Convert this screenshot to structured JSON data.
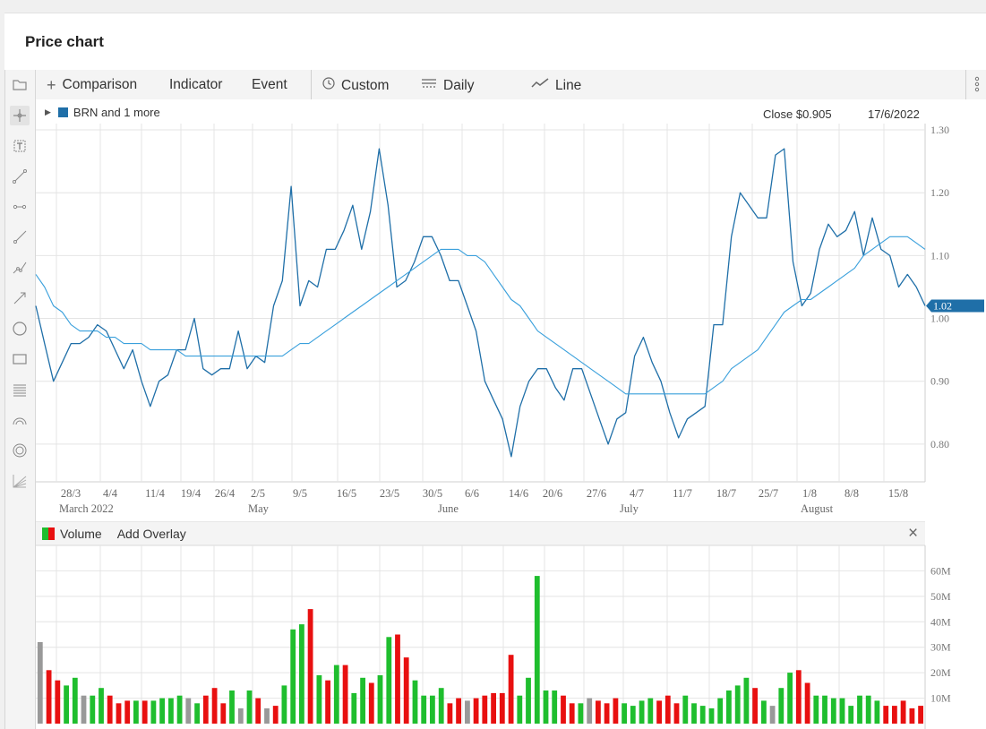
{
  "page": {
    "title": "Price chart"
  },
  "toolbar": {
    "comparison_label": "Comparison",
    "indicator_label": "Indicator",
    "event_label": "Event",
    "custom_label": "Custom",
    "daily_label": "Daily",
    "line_label": "Line"
  },
  "left_tools": [
    "folder-icon",
    "crosshair-icon",
    "text-box-icon",
    "trend-line-icon",
    "horizontal-segment-icon",
    "ray-line-icon",
    "polyline-icon",
    "arrow-line-icon",
    "circle-icon",
    "rectangle-icon",
    "fibonacci-lines-icon",
    "arcs-icon",
    "concentric-circles-icon",
    "fan-lines-icon"
  ],
  "legend": {
    "series_label": "BRN and 1 more",
    "close_text": "Close $0.905",
    "date_text": "17/6/2022",
    "last_value_tag": "1.02",
    "series_color": "#1f6fa8"
  },
  "volume_panel": {
    "title": "Volume",
    "add_overlay_label": "Add Overlay",
    "close_symbol": "×"
  },
  "colors": {
    "up": "#1fbe2e",
    "down": "#e81010",
    "neutral": "#999999",
    "price": "#1f6fa8",
    "ma": "#3aa0dc"
  },
  "chart_data": [
    {
      "type": "line",
      "y_ticks": [
        "1.30",
        "1.20",
        "1.10",
        "1.00",
        "0.90",
        "0.80"
      ],
      "x_ticks": [
        "28/3",
        "4/4",
        "11/4",
        "19/4",
        "26/4",
        "2/5",
        "9/5",
        "16/5",
        "23/5",
        "30/5",
        "6/6",
        "14/6",
        "20/6",
        "27/6",
        "4/7",
        "11/7",
        "18/7",
        "25/7",
        "1/8",
        "8/8",
        "15/8"
      ],
      "month_labels": [
        "March 2022",
        "May",
        "June",
        "July",
        "August"
      ],
      "ylim": [
        0.74,
        1.31
      ],
      "grid": true,
      "series": [
        {
          "values": [
            1.02,
            0.96,
            0.9,
            0.93,
            0.96,
            0.96,
            0.97,
            0.99,
            0.98,
            0.95,
            0.92,
            0.95,
            0.9,
            0.86,
            0.9,
            0.91,
            0.95,
            0.95,
            1.0,
            0.92,
            0.91,
            0.92,
            0.92,
            0.98,
            0.92,
            0.94,
            0.93,
            1.02,
            1.06,
            1.21,
            1.02,
            1.06,
            1.05,
            1.11,
            1.11,
            1.14,
            1.18,
            1.11,
            1.17,
            1.27,
            1.18,
            1.05,
            1.06,
            1.09,
            1.13,
            1.13,
            1.1,
            1.06,
            1.06,
            1.02,
            0.98,
            0.9,
            0.87,
            0.84,
            0.78,
            0.86,
            0.9,
            0.92,
            0.92,
            0.89,
            0.87,
            0.92,
            0.92,
            0.88,
            0.84,
            0.8,
            0.84,
            0.85,
            0.94,
            0.97,
            0.93,
            0.9,
            0.85,
            0.81,
            0.84,
            0.85,
            0.86,
            0.99,
            0.99,
            1.13,
            1.2,
            1.18,
            1.16,
            1.16,
            1.26,
            1.27,
            1.09,
            1.02,
            1.04,
            1.11,
            1.15,
            1.13,
            1.14,
            1.17,
            1.1,
            1.16,
            1.11,
            1.1,
            1.05,
            1.07,
            1.05,
            1.02
          ]
        },
        {
          "values": [
            1.07,
            1.05,
            1.02,
            1.01,
            0.99,
            0.98,
            0.98,
            0.98,
            0.97,
            0.97,
            0.96,
            0.96,
            0.96,
            0.95,
            0.95,
            0.95,
            0.95,
            0.94,
            0.94,
            0.94,
            0.94,
            0.94,
            0.94,
            0.94,
            0.94,
            0.94,
            0.94,
            0.94,
            0.94,
            0.95,
            0.96,
            0.96,
            0.97,
            0.98,
            0.99,
            1.0,
            1.01,
            1.02,
            1.03,
            1.04,
            1.05,
            1.06,
            1.07,
            1.08,
            1.09,
            1.1,
            1.11,
            1.11,
            1.11,
            1.1,
            1.1,
            1.09,
            1.07,
            1.05,
            1.03,
            1.02,
            1.0,
            0.98,
            0.97,
            0.96,
            0.95,
            0.94,
            0.93,
            0.92,
            0.91,
            0.9,
            0.89,
            0.88,
            0.88,
            0.88,
            0.88,
            0.88,
            0.88,
            0.88,
            0.88,
            0.88,
            0.88,
            0.89,
            0.9,
            0.92,
            0.93,
            0.94,
            0.95,
            0.97,
            0.99,
            1.01,
            1.02,
            1.03,
            1.03,
            1.04,
            1.05,
            1.06,
            1.07,
            1.08,
            1.1,
            1.11,
            1.12,
            1.13,
            1.13,
            1.13,
            1.12,
            1.11
          ]
        }
      ]
    },
    {
      "type": "bar",
      "y_ticks": [
        "60M",
        "50M",
        "40M",
        "30M",
        "20M",
        "10M"
      ],
      "ylim": [
        0,
        70
      ],
      "grid": true,
      "values": [
        32,
        21,
        17,
        15,
        18,
        11,
        11,
        14,
        11,
        8,
        9,
        9,
        9,
        9,
        10,
        10,
        11,
        10,
        8,
        11,
        14,
        8,
        13,
        6,
        13,
        10,
        6,
        7,
        15,
        37,
        39,
        45,
        19,
        17,
        23,
        23,
        12,
        18,
        16,
        19,
        34,
        35,
        26,
        17,
        11,
        11,
        14,
        8,
        10,
        9,
        10,
        11,
        12,
        12,
        27,
        11,
        18,
        58,
        13,
        13,
        11,
        8,
        8,
        10,
        9,
        8,
        10,
        8,
        7,
        9,
        10,
        9,
        11,
        8,
        11,
        8,
        7,
        6,
        10,
        13,
        15,
        18,
        14,
        9,
        7,
        14,
        20,
        21,
        16,
        11,
        11,
        10,
        10,
        7,
        11,
        11,
        9,
        7,
        7,
        9,
        6,
        7
      ],
      "colors": [
        "n",
        "d",
        "d",
        "u",
        "u",
        "n",
        "u",
        "u",
        "d",
        "d",
        "d",
        "u",
        "d",
        "u",
        "u",
        "u",
        "u",
        "n",
        "u",
        "d",
        "d",
        "d",
        "u",
        "n",
        "u",
        "d",
        "n",
        "d",
        "u",
        "u",
        "u",
        "d",
        "u",
        "d",
        "u",
        "d",
        "u",
        "u",
        "d",
        "u",
        "u",
        "d",
        "d",
        "u",
        "u",
        "u",
        "u",
        "d",
        "d",
        "n",
        "d",
        "d",
        "d",
        "d",
        "d",
        "u",
        "u",
        "u",
        "u",
        "u",
        "d",
        "d",
        "u",
        "n",
        "d",
        "d",
        "d",
        "u",
        "u",
        "u",
        "u",
        "d",
        "d",
        "d",
        "u",
        "u",
        "u",
        "u",
        "u",
        "u",
        "u",
        "u",
        "d",
        "u",
        "n",
        "u",
        "u",
        "d",
        "d",
        "u",
        "u",
        "u",
        "u",
        "u",
        "u",
        "u",
        "u",
        "d",
        "d",
        "d",
        "d",
        "d"
      ]
    }
  ]
}
